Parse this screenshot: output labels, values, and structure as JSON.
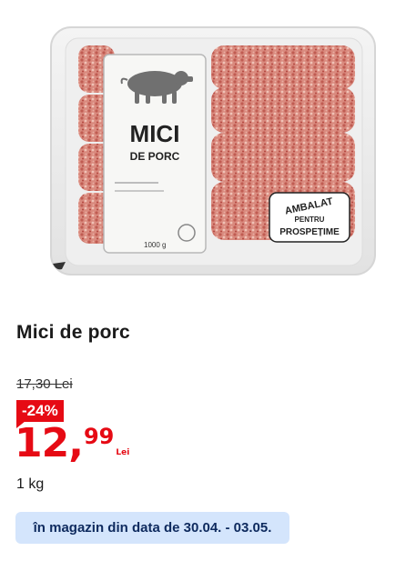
{
  "product": {
    "title": "Mici de porc",
    "image": {
      "label_line1": "MICI",
      "label_line2": "DE PORC",
      "net_weight": "1000 g",
      "badge_line1": "AMBALAT",
      "badge_line2": "PENTRU",
      "badge_line3": "PROSPEȚIME"
    }
  },
  "pricing": {
    "old_price": "17,30 Lei",
    "discount": "-24%",
    "price_main": "12,",
    "price_cents": "99",
    "currency": "Lei",
    "unit": "1 kg"
  },
  "availability": {
    "text": "în magazin din data de 30.04. - 03.05."
  },
  "colors": {
    "accent": "#e60a14",
    "info_bg": "#d4e5fc",
    "info_text": "#0e2a5e"
  }
}
